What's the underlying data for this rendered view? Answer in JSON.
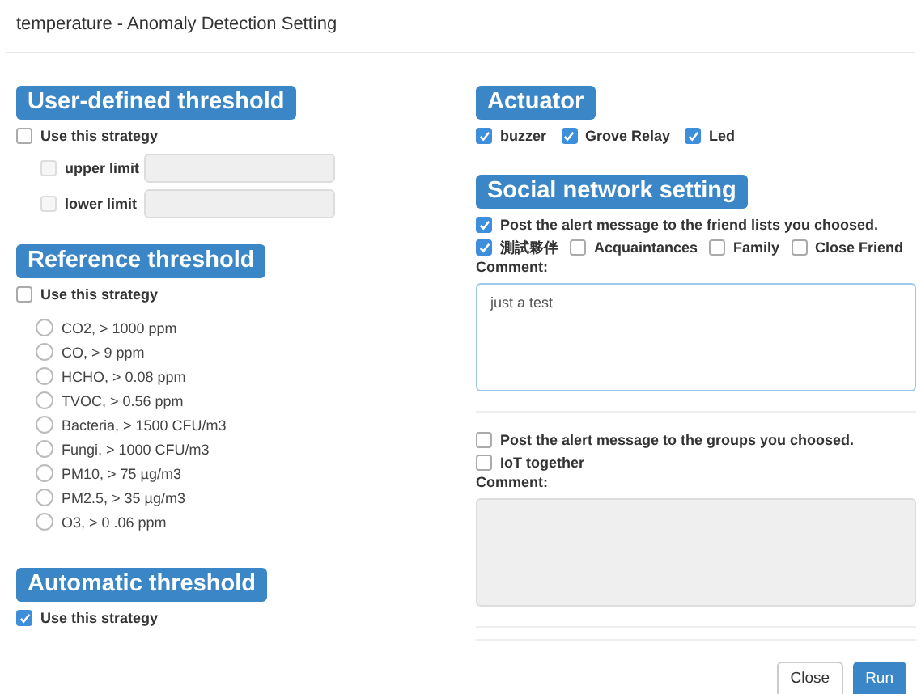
{
  "window": {
    "title": "temperature - Anomaly Detection Setting"
  },
  "left_sections": [
    {
      "kind": "limits",
      "heading": "User-defined threshold",
      "strategy": {
        "label": "Use this strategy",
        "checked": false
      },
      "limits": [
        {
          "label": "upper limit",
          "checked": false,
          "disabled": true
        },
        {
          "label": "lower limit",
          "checked": false,
          "disabled": true
        }
      ]
    },
    {
      "kind": "options",
      "heading": "Reference threshold",
      "strategy": {
        "label": "Use this strategy",
        "checked": false
      },
      "options": [
        {
          "label": "CO2, > 1000 ppm",
          "selected": false
        },
        {
          "label": "CO, > 9 ppm",
          "selected": false
        },
        {
          "label": "HCHO, > 0.08 ppm",
          "selected": false
        },
        {
          "label": "TVOC, > 0.56 ppm",
          "selected": false
        },
        {
          "label": "Bacteria, > 1500 CFU/m3",
          "selected": false
        },
        {
          "label": "Fungi, > 1000 CFU/m3",
          "selected": false
        },
        {
          "label": "PM10, > 75 µg/m3",
          "selected": false
        },
        {
          "label": "PM2.5, > 35 µg/m3",
          "selected": false
        },
        {
          "label": "O3, >  0 .06 ppm",
          "selected": false
        }
      ]
    },
    {
      "kind": "plain",
      "heading": "Automatic threshold",
      "strategy": {
        "label": "Use this strategy",
        "checked": true
      }
    }
  ],
  "actuator": {
    "heading": "Actuator",
    "items": [
      {
        "label": "buzzer",
        "checked": true
      },
      {
        "label": "Grove Relay",
        "checked": true
      },
      {
        "label": "Led",
        "checked": true
      }
    ]
  },
  "social": {
    "heading": "Social network setting",
    "friend_post": {
      "label": "Post the alert message to the friend lists you choosed.",
      "checked": true
    },
    "friend_lists": [
      {
        "label": "測試夥伴",
        "checked": true
      },
      {
        "label": "Acquaintances",
        "checked": false
      },
      {
        "label": "Family",
        "checked": false
      },
      {
        "label": "Close Friend",
        "checked": false
      }
    ],
    "friend_comment": {
      "label": "Comment:",
      "value": "just a test",
      "disabled": false
    },
    "group_post": {
      "label": "Post the alert message to the groups you choosed.",
      "checked": false
    },
    "groups": [
      {
        "label": "IoT together",
        "checked": false
      }
    ],
    "group_comment": {
      "label": "Comment:",
      "disabled": true
    }
  },
  "buttons": [
    {
      "label": "Close",
      "kind": "default"
    },
    {
      "label": "Run",
      "kind": "primary"
    }
  ]
}
